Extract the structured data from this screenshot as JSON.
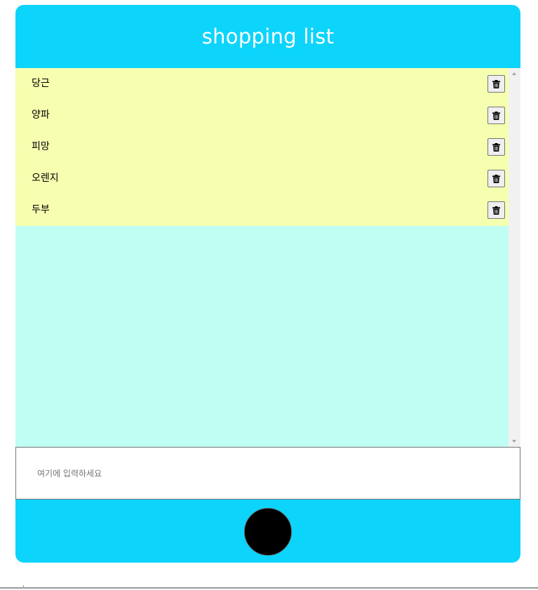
{
  "header": {
    "title": "shopping list"
  },
  "list": {
    "items": [
      {
        "label": "당근"
      },
      {
        "label": "양파"
      },
      {
        "label": "피망"
      },
      {
        "label": "오렌지"
      },
      {
        "label": "두부"
      }
    ],
    "delete_icon": "trash-icon"
  },
  "input": {
    "placeholder": "여기에 입력하세요",
    "value": ""
  },
  "colors": {
    "header_footer": "#0dd4fb",
    "item_background": "#f6ffb0",
    "list_background": "#c0fdf3",
    "add_button": "#000000"
  }
}
